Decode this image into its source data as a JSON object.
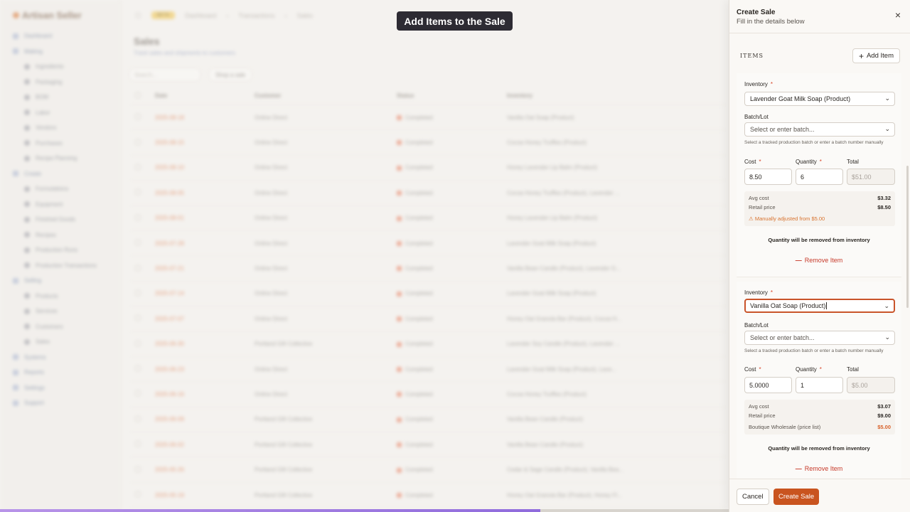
{
  "background": {
    "brand": "Artisan Seller",
    "nav": [
      {
        "label": "Dashboard",
        "sub": false
      },
      {
        "label": "Making",
        "sub": false
      },
      {
        "label": "Ingredients",
        "sub": true
      },
      {
        "label": "Packaging",
        "sub": true
      },
      {
        "label": "BOM",
        "sub": true
      },
      {
        "label": "Labor",
        "sub": true
      },
      {
        "label": "Vendors",
        "sub": true
      },
      {
        "label": "Purchases",
        "sub": true
      },
      {
        "label": "Recipe Planning",
        "sub": true
      },
      {
        "label": "Create",
        "sub": false
      },
      {
        "label": "Formulations",
        "sub": true
      },
      {
        "label": "Equipment",
        "sub": true
      },
      {
        "label": "Finished Goods",
        "sub": true
      },
      {
        "label": "Recipes",
        "sub": true
      },
      {
        "label": "Production Runs",
        "sub": true
      },
      {
        "label": "Production Transactions",
        "sub": true
      },
      {
        "label": "Selling",
        "sub": false
      },
      {
        "label": "Products",
        "sub": true
      },
      {
        "label": "Services",
        "sub": true
      },
      {
        "label": "Customers",
        "sub": true
      },
      {
        "label": "Sales",
        "sub": true
      },
      {
        "label": "Systems",
        "sub": false
      },
      {
        "label": "Reports",
        "sub": false
      },
      {
        "label": "Settings",
        "sub": false
      },
      {
        "label": "Support",
        "sub": false
      }
    ],
    "breadcrumbs": [
      "BETA",
      "Dashboard",
      "Transactions",
      "Sales"
    ],
    "title": "Sales",
    "subtitle": "Track sales and shipments to customers",
    "search_placeholder": "Search...",
    "shop_button": "Shop a sale",
    "columns": [
      "Date",
      "Customer",
      "Status",
      "Inventory"
    ],
    "rows": [
      {
        "date": "2025-08-18",
        "customer": "Online Direct",
        "status": "Completed",
        "inventory": "Vanilla Oat Soap (Product)"
      },
      {
        "date": "2025-08-15",
        "customer": "Online Direct",
        "status": "Completed",
        "inventory": "Cocoa Honey Truffles (Product)"
      },
      {
        "date": "2025-08-10",
        "customer": "Online Direct",
        "status": "Completed",
        "inventory": "Honey Lavender Lip Balm (Product)"
      },
      {
        "date": "2025-08-05",
        "customer": "Online Direct",
        "status": "Completed",
        "inventory": "Cocoa Honey Truffles (Product), Lavender ..."
      },
      {
        "date": "2025-08-01",
        "customer": "Online Direct",
        "status": "Completed",
        "inventory": "Honey Lavender Lip Balm (Product)"
      },
      {
        "date": "2025-07-28",
        "customer": "Online Direct",
        "status": "Completed",
        "inventory": "Lavender Goat Milk Soap (Product)"
      },
      {
        "date": "2025-07-21",
        "customer": "Online Direct",
        "status": "Completed",
        "inventory": "Vanilla Bean Candle (Product), Lavender G..."
      },
      {
        "date": "2025-07-14",
        "customer": "Online Direct",
        "status": "Completed",
        "inventory": "Lavender Goat Milk Soap (Product)"
      },
      {
        "date": "2025-07-07",
        "customer": "Online Direct",
        "status": "Completed",
        "inventory": "Honey Oat Granola Bar (Product), Cocoa H..."
      },
      {
        "date": "2025-06-30",
        "customer": "Portland Gift Collective",
        "status": "Completed",
        "inventory": "Lavender Soy Candle (Product), Lavender ..."
      },
      {
        "date": "2025-06-23",
        "customer": "Online Direct",
        "status": "Completed",
        "inventory": "Lavender Goat Milk Soap (Product), Lave..."
      },
      {
        "date": "2025-06-16",
        "customer": "Online Direct",
        "status": "Completed",
        "inventory": "Cocoa Honey Truffles (Product)"
      },
      {
        "date": "2025-06-09",
        "customer": "Portland Gift Collective",
        "status": "Completed",
        "inventory": "Vanilla Bean Candle (Product)"
      },
      {
        "date": "2025-06-02",
        "customer": "Portland Gift Collective",
        "status": "Completed",
        "inventory": "Vanilla Bean Candle (Product)"
      },
      {
        "date": "2025-05-26",
        "customer": "Portland Gift Collective",
        "status": "Completed",
        "inventory": "Cedar & Sage Candle (Product), Vanilla Bea..."
      },
      {
        "date": "2025-05-19",
        "customer": "Portland Gift Collective",
        "status": "Completed",
        "inventory": "Honey Oat Granola Bar (Product), Honey Fl..."
      }
    ]
  },
  "banner": {
    "text": "Add Items to the Sale"
  },
  "drawer": {
    "title": "Create Sale",
    "subtitle": "Fill in the details below",
    "close_icon": "×",
    "items_label": "ITEMS",
    "add_item_label": "Add Item",
    "field_labels": {
      "inventory": "Inventory",
      "batch": "Batch/Lot",
      "cost": "Cost",
      "quantity": "Quantity",
      "total": "Total",
      "required_mark": "*"
    },
    "batch_placeholder": "Select or enter batch...",
    "batch_helper": "Select a tracked production batch or enter a batch number manually",
    "quantity_note": "Quantity will be removed from inventory",
    "remove_label": "Remove Item",
    "items": [
      {
        "inventory": "Lavender Goat Milk Soap (Product)",
        "cost": "8.50",
        "quantity": "6",
        "total": "$51.00",
        "avg_cost_label": "Avg cost",
        "avg_cost": "$3.32",
        "retail_price_label": "Retail price",
        "retail_price": "$8.50",
        "warning": "Manually adjusted from $5.00"
      },
      {
        "inventory": "Vanilla Oat Soap (Product)",
        "cost": "5.0000",
        "quantity": "1",
        "total": "$5.00",
        "avg_cost_label": "Avg cost",
        "avg_cost": "$3.07",
        "retail_price_label": "Retail price",
        "retail_price": "$9.00",
        "price_list_label": "Boutique Wholesale (price list)",
        "price_list_value": "$5.00"
      }
    ],
    "cancel_label": "Cancel",
    "create_label": "Create Sale"
  },
  "colors": {
    "accent": "#c9541f",
    "danger": "#c73a2a",
    "warning": "#d8732f",
    "banner_bg": "#2d2b33"
  }
}
